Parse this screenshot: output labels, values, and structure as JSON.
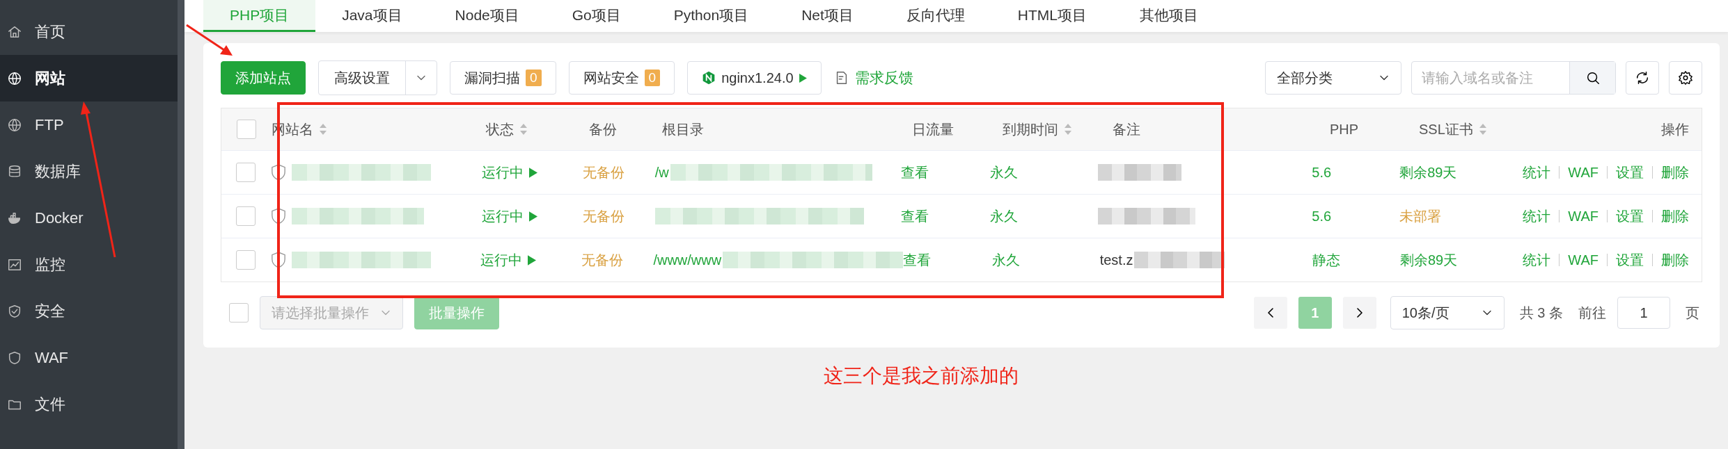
{
  "sidebar": {
    "items": [
      {
        "label": "首页",
        "selected": false
      },
      {
        "label": "网站",
        "selected": true
      },
      {
        "label": "FTP",
        "selected": false
      },
      {
        "label": "数据库",
        "selected": false
      },
      {
        "label": "Docker",
        "selected": false
      },
      {
        "label": "监控",
        "selected": false
      },
      {
        "label": "安全",
        "selected": false
      },
      {
        "label": "WAF",
        "selected": false
      },
      {
        "label": "文件",
        "selected": false
      }
    ]
  },
  "project_tabs": [
    {
      "label": "PHP项目",
      "selected": true
    },
    {
      "label": "Java项目",
      "selected": false
    },
    {
      "label": "Node项目",
      "selected": false
    },
    {
      "label": "Go项目",
      "selected": false
    },
    {
      "label": "Python项目",
      "selected": false
    },
    {
      "label": "Net项目",
      "selected": false
    },
    {
      "label": "反向代理",
      "selected": false
    },
    {
      "label": "HTML项目",
      "selected": false
    },
    {
      "label": "其他项目",
      "selected": false
    }
  ],
  "toolbar": {
    "add_button": "添加站点",
    "advanced_button": "高级设置",
    "vuln_scan": {
      "label": "漏洞扫描",
      "count": "0"
    },
    "site_security": {
      "label": "网站安全",
      "count": "0"
    },
    "nginx_button": "nginx1.24.0",
    "feedback_link": "需求反馈",
    "category_select": "全部分类",
    "search": {
      "placeholder": "请输入域名或备注"
    }
  },
  "table": {
    "select_all": {
      "checked": false
    },
    "columns": [
      {
        "label": "网站名",
        "sortable": true
      },
      {
        "label": "状态",
        "sortable": true
      },
      {
        "label": "备份",
        "sortable": false
      },
      {
        "label": "根目录",
        "sortable": false
      },
      {
        "label": "日流量",
        "sortable": false
      },
      {
        "label": "到期时间",
        "sortable": true
      },
      {
        "label": "备注",
        "sortable": false
      },
      {
        "label": "PHP",
        "sortable": false
      },
      {
        "label": "SSL证书",
        "sortable": true
      },
      {
        "label": "操作",
        "sortable": false
      }
    ],
    "rows": [
      {
        "checked": false,
        "status": "运行中",
        "backup": "无备份",
        "root_dir": "/w",
        "traffic": "查看",
        "expiry": "永久",
        "php": "5.6",
        "ssl": {
          "text": "剩余89天",
          "deployed": true
        },
        "actions": [
          "统计",
          "WAF",
          "设置",
          "删除"
        ]
      },
      {
        "checked": false,
        "status": "运行中",
        "backup": "无备份",
        "traffic": "查看",
        "expiry": "永久",
        "php": "5.6",
        "ssl": {
          "text": "未部署",
          "deployed": false
        },
        "actions": [
          "统计",
          "WAF",
          "设置",
          "删除"
        ]
      },
      {
        "checked": false,
        "status": "运行中",
        "backup": "无备份",
        "root_dir": "/www/www",
        "traffic": "查看",
        "expiry": "永久",
        "note": "test.z",
        "php": "静态",
        "ssl": {
          "text": "剩余89天",
          "deployed": true
        },
        "actions": [
          "统计",
          "WAF",
          "设置",
          "删除"
        ]
      }
    ]
  },
  "footer": {
    "select_all": {
      "checked": false
    },
    "batch_select": {
      "placeholder": "请选择批量操作"
    },
    "batch_button": "批量操作",
    "pagination": {
      "pages": [
        {
          "label": "1",
          "selected": true
        }
      ],
      "page_size": "10条/页",
      "total": "共 3 条",
      "goto_label": "前往",
      "goto_value": "1",
      "page_unit": "页"
    }
  },
  "annotation": {
    "text": "这三个是我之前添加的"
  }
}
